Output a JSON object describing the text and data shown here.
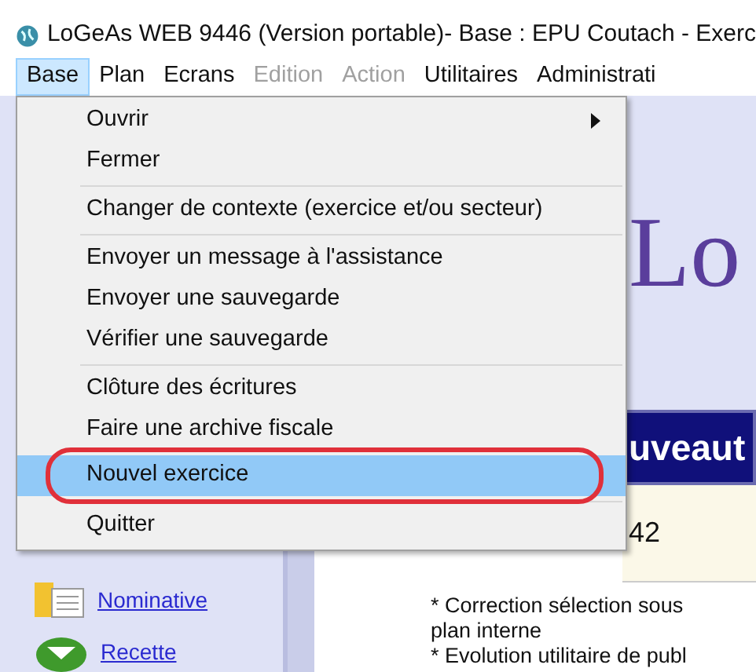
{
  "window": {
    "title": "LoGeAs WEB 9446 (Version portable)- Base : EPU Coutach - Exerc"
  },
  "menubar": [
    {
      "label": "Base",
      "selected": true,
      "disabled": false
    },
    {
      "label": "Plan",
      "selected": false,
      "disabled": false
    },
    {
      "label": "Ecrans",
      "selected": false,
      "disabled": false
    },
    {
      "label": "Edition",
      "selected": false,
      "disabled": true
    },
    {
      "label": "Action",
      "selected": false,
      "disabled": true
    },
    {
      "label": "Utilitaires",
      "selected": false,
      "disabled": false
    },
    {
      "label": "Administrati",
      "selected": false,
      "disabled": false
    }
  ],
  "menu": [
    {
      "kind": "item",
      "label": "Ouvrir",
      "submenu": true,
      "selected": false
    },
    {
      "kind": "item",
      "label": "Fermer",
      "submenu": false,
      "selected": false
    },
    {
      "kind": "separator"
    },
    {
      "kind": "item",
      "label": "Changer de contexte (exercice et/ou secteur)",
      "submenu": false,
      "selected": false
    },
    {
      "kind": "separator"
    },
    {
      "kind": "item",
      "label": "Envoyer un message à l'assistance",
      "submenu": false,
      "selected": false
    },
    {
      "kind": "item",
      "label": "Envoyer une sauvegarde",
      "submenu": false,
      "selected": false
    },
    {
      "kind": "item",
      "label": "Vérifier une sauvegarde",
      "submenu": false,
      "selected": false
    },
    {
      "kind": "separator"
    },
    {
      "kind": "item",
      "label": "Clôture des écritures",
      "submenu": false,
      "selected": false
    },
    {
      "kind": "item",
      "label": "Faire une archive fiscale",
      "submenu": false,
      "selected": false
    },
    {
      "kind": "item",
      "label": "Nouvel exercice",
      "submenu": false,
      "selected": true,
      "annotated": true
    },
    {
      "kind": "separator"
    },
    {
      "kind": "item",
      "label": "Quitter",
      "submenu": false,
      "selected": false
    }
  ],
  "sidebar": {
    "items": [
      {
        "label": "Nominative"
      },
      {
        "label": "Recette"
      }
    ]
  },
  "content": {
    "logo": "Lo",
    "banner": "uveaut",
    "number": "42",
    "notes": [
      "* Correction sélection sous",
      "plan interne",
      "* Evolution utilitaire de publ"
    ]
  }
}
